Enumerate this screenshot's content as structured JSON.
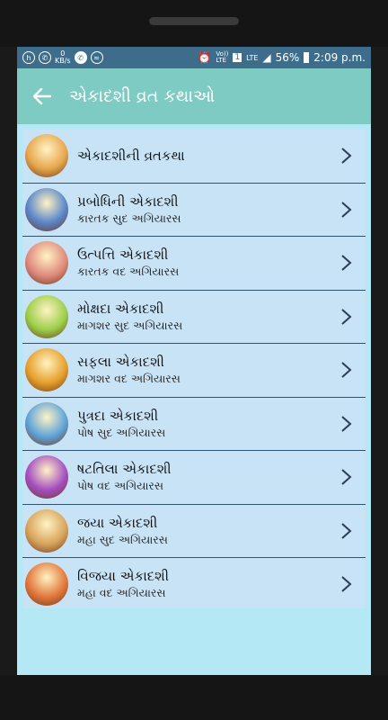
{
  "status": {
    "left_icons": [
      "hike-icon",
      "whatsapp-icon",
      "data-speed-icon",
      "phone-icon",
      "wifi-icon"
    ],
    "speed": "0",
    "speed_unit": "KB/s",
    "volte": "Vo))\nLTE",
    "sim": "1",
    "lte": "LTE",
    "battery": "56%",
    "time": "2:09 p.m."
  },
  "appbar": {
    "title": "એકાદશી વ્રત કથાઓ"
  },
  "items": [
    {
      "title": "એકાદશીની વ્રતકથા",
      "subtitle": "",
      "color": "#e7a74d"
    },
    {
      "title": "પ્રબોધિની એકાદશી",
      "subtitle": "કારતક સુદ અગિયારસ",
      "color": "#5a86c9"
    },
    {
      "title": "ઉત્પત્તિ એકાદશી",
      "subtitle": "કારતક વદ અગિયારસ",
      "color": "#e08a7d"
    },
    {
      "title": "મોક્ષદા એકાદશી",
      "subtitle": "માગશર સુદ અગિયારસ",
      "color": "#9ccf4a"
    },
    {
      "title": "સફલા એકાદશી",
      "subtitle": "માગશર વદ અગિયારસ",
      "color": "#e6a02b"
    },
    {
      "title": "પુત્રદા એકાદશી",
      "subtitle": "પોષ સુદ અગિયારસ",
      "color": "#5fa3d9"
    },
    {
      "title": "ષટતિલા એકાદશી",
      "subtitle": "પોષ વદ અગિયારસ",
      "color": "#a44ec1"
    },
    {
      "title": "જયા એકાદશી",
      "subtitle": "મહા સુદ અગિયારસ",
      "color": "#d8a45c"
    },
    {
      "title": "વિજયા એકાદશી",
      "subtitle": "મહા વદ અગિયારસ",
      "color": "#e3773b"
    }
  ]
}
